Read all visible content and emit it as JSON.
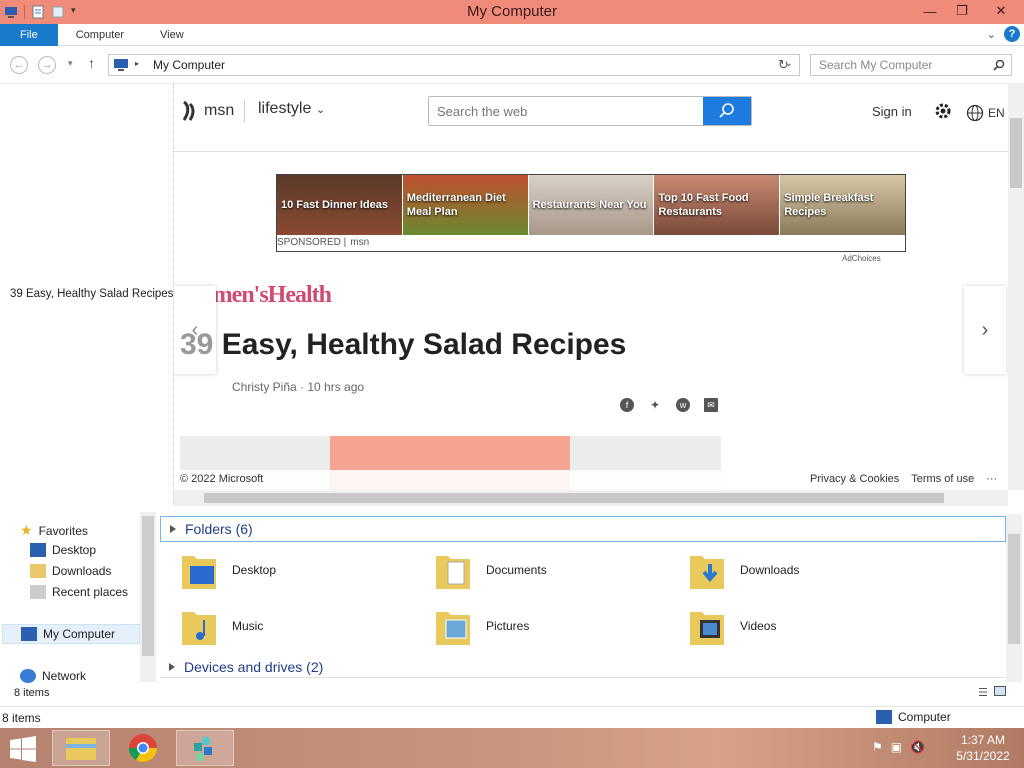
{
  "window": {
    "title": "My Computer"
  },
  "ribbon": {
    "tabs": [
      "File",
      "Computer",
      "View"
    ]
  },
  "address": {
    "crumb": "My Computer",
    "search_placeholder": "Search My Computer"
  },
  "preview": {
    "doc_title": "39 Easy, Healthy Salad Recipes"
  },
  "msn": {
    "brand": "msn",
    "section": "lifestyle",
    "search_placeholder": "Search the web",
    "signin": "Sign in",
    "lang": "EN",
    "ad_tiles": [
      "10 Fast Dinner Ideas",
      "Mediterranean Diet Meal Plan",
      "Restaurants Near You",
      "Top 10 Fast Food Restaurants",
      "Simple Breakfast Recipes"
    ],
    "ad_sponsored": "SPONSORED |",
    "ad_brand": "msn",
    "adchoices": "AdChoices",
    "publisher": "Women'sHealth",
    "article_number": "39",
    "article_title": "Easy, Healthy Salad Recipes",
    "byline": "Christy Piña · 10 hrs ago",
    "copyright": "© 2022 Microsoft",
    "privacy": "Privacy & Cookies",
    "terms": "Terms of use",
    "more": "···"
  },
  "nav": {
    "favorites": "Favorites",
    "desktop": "Desktop",
    "downloads": "Downloads",
    "recent": "Recent places",
    "my_computer": "My Computer",
    "network": "Network"
  },
  "content": {
    "folders_header": "Folders (6)",
    "folders": [
      "Desktop",
      "Documents",
      "Downloads",
      "Music",
      "Pictures",
      "Videos"
    ],
    "devices_header": "Devices and drives (2)"
  },
  "status": {
    "pane_items": "8 items",
    "items": "8 items",
    "location": "Computer"
  },
  "clock": {
    "time": "1:37 AM",
    "date": "5/31/2022"
  },
  "colors": {
    "titlebar": "#f08a7a",
    "accent": "#1979ca",
    "msn_search": "#1e7be0"
  }
}
